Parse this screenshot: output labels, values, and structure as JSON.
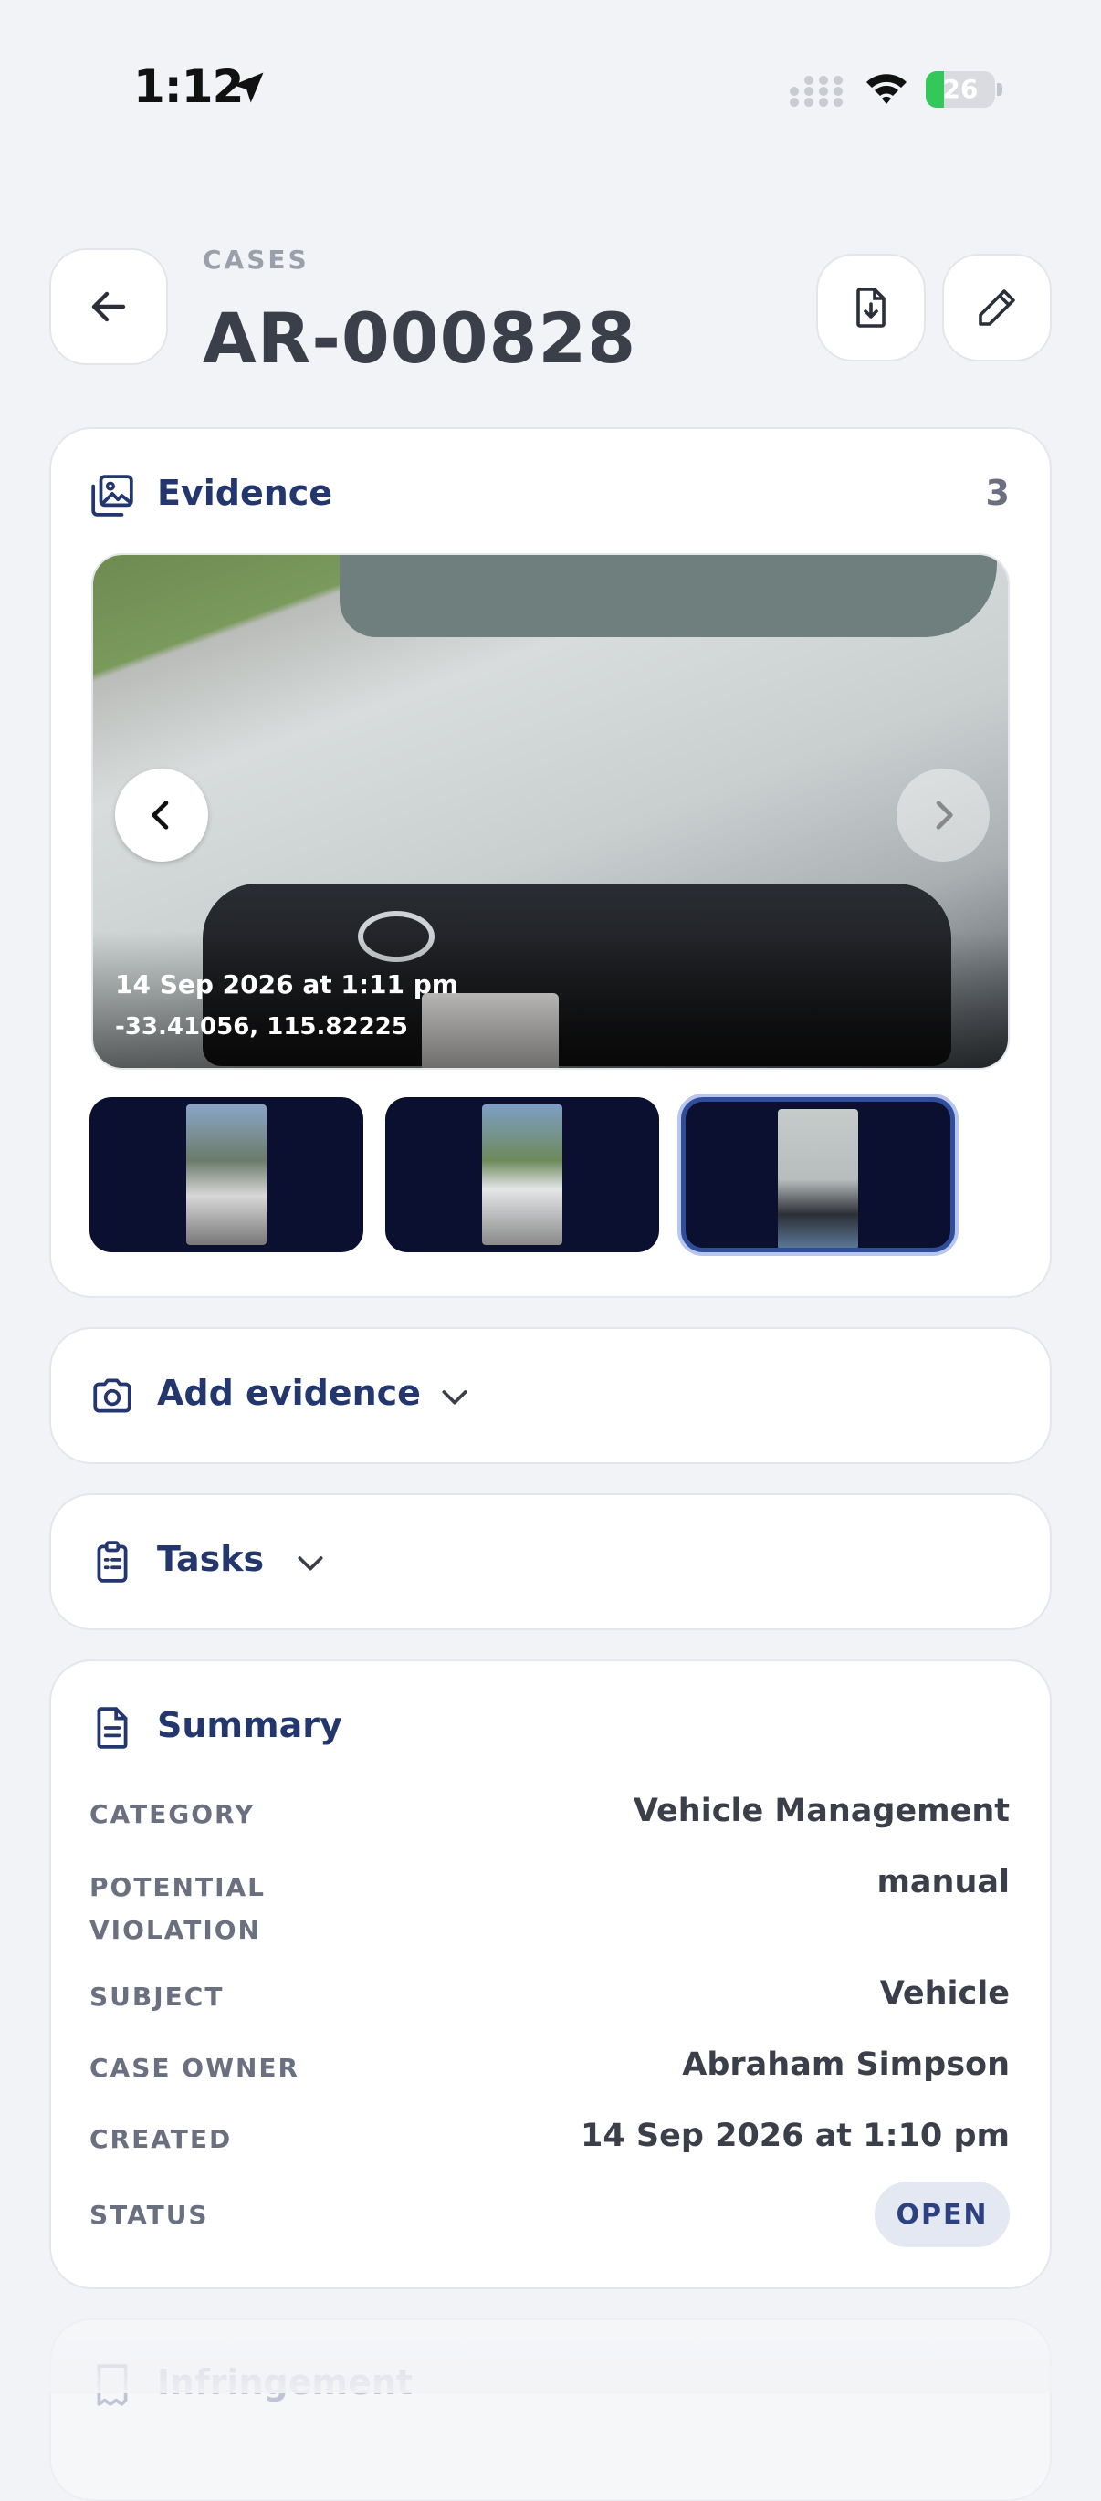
{
  "status_bar": {
    "time": "1:12",
    "battery": "26",
    "battery_percent": 26
  },
  "header": {
    "breadcrumb": "CASES",
    "case_id": "AR-000828"
  },
  "evidence": {
    "title": "Evidence",
    "count": "3",
    "photo": {
      "timestamp": "14 Sep 2026 at 1:11 pm",
      "coordinates": "-33.41056, 115.82225"
    },
    "thumbnails": [
      {
        "selected": false
      },
      {
        "selected": false
      },
      {
        "selected": true
      }
    ]
  },
  "add_evidence": {
    "label": "Add evidence"
  },
  "tasks": {
    "label": "Tasks"
  },
  "summary": {
    "title": "Summary",
    "rows": [
      {
        "label": "CATEGORY",
        "value": "Vehicle Management"
      },
      {
        "label": "POTENTIAL VIOLATION",
        "value": "manual"
      },
      {
        "label": "SUBJECT",
        "value": "Vehicle"
      },
      {
        "label": "CASE OWNER",
        "value": "Abraham Simpson"
      },
      {
        "label": "CREATED",
        "value": "14 Sep 2026 at 1:10 pm"
      },
      {
        "label": "STATUS",
        "value": "OPEN"
      }
    ]
  },
  "next_section": {
    "title": "Infringement"
  },
  "colors": {
    "accent": "#23366e",
    "selected_border": "#2f4d9b",
    "badge_bg": "#e4e8f2",
    "battery_green": "#34c759"
  },
  "icons": [
    "location-arrow-icon",
    "cellular-signal-icon",
    "wifi-icon",
    "battery-icon",
    "back-arrow-icon",
    "download-file-icon",
    "pencil-icon",
    "gallery-icon",
    "camera-icon",
    "clipboard-icon",
    "document-icon",
    "chevron-down-icon",
    "chevron-left-icon",
    "chevron-right-icon",
    "receipt-icon"
  ]
}
